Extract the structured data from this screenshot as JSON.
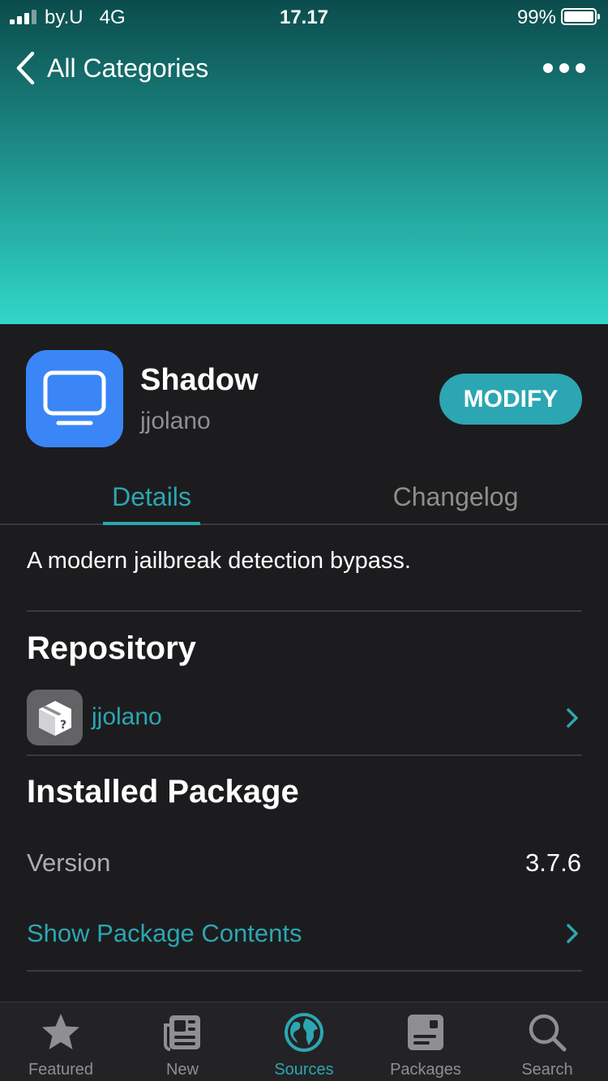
{
  "status_bar": {
    "carrier": "by.U",
    "network": "4G",
    "time": "17.17",
    "battery": "99%"
  },
  "nav": {
    "back_label": "All Categories"
  },
  "package": {
    "name": "Shadow",
    "author": "jjolano",
    "action_label": "MODIFY"
  },
  "tabs": {
    "details": "Details",
    "changelog": "Changelog"
  },
  "description": "A modern jailbreak detection bypass.",
  "repository": {
    "title": "Repository",
    "name": "jjolano"
  },
  "installed": {
    "title": "Installed Package",
    "version_label": "Version",
    "version_value": "3.7.6",
    "contents_label": "Show Package Contents"
  },
  "tabbar": {
    "items": [
      {
        "label": "Featured",
        "icon": "star-icon"
      },
      {
        "label": "New",
        "icon": "newspaper-icon"
      },
      {
        "label": "Sources",
        "icon": "globe-icon"
      },
      {
        "label": "Packages",
        "icon": "package-icon"
      },
      {
        "label": "Search",
        "icon": "search-icon"
      }
    ],
    "active_index": 2
  },
  "colors": {
    "accent": "#2ca6b2",
    "icon_blue": "#3a86f7",
    "background": "#1c1c1e"
  }
}
